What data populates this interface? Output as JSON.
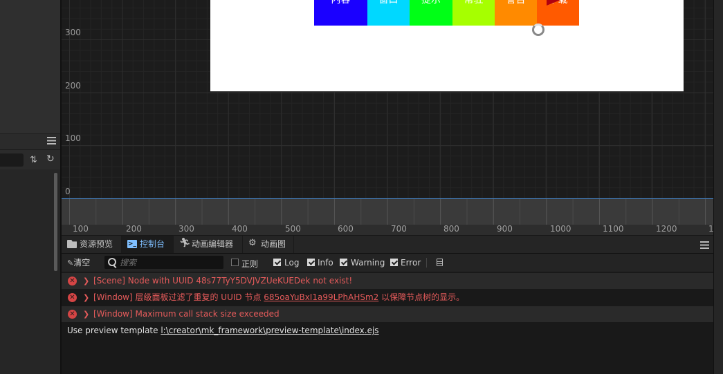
{
  "scene": {
    "y_labels": [
      "300",
      "200",
      "100",
      "0"
    ],
    "x_labels": [
      "100",
      "200",
      "300",
      "400",
      "500",
      "600",
      "700",
      "800",
      "900",
      "1000",
      "1100",
      "1200",
      "1"
    ],
    "canvas_buttons": [
      {
        "label": "内容",
        "color": "#1a00ff"
      },
      {
        "label": "窗口",
        "color": "#00d8ff"
      },
      {
        "label": "提示",
        "color": "#00ff16"
      },
      {
        "label": "常驻",
        "color": "#a6ff00"
      },
      {
        "label": "警告",
        "color": "#ff8a00"
      },
      {
        "label": "下载",
        "color": "#ff5a00"
      }
    ]
  },
  "tabs": [
    {
      "label": "资源预览",
      "icon": "folder-icon"
    },
    {
      "label": "控制台",
      "icon": "terminal-icon"
    },
    {
      "label": "动画编辑器",
      "icon": "running-figure-icon"
    },
    {
      "label": "动画图",
      "icon": "animation-graph-icon"
    }
  ],
  "toolbar": {
    "clear_label": "清空",
    "search_placeholder": "搜索",
    "filters": [
      {
        "label": "正则",
        "checked": false
      },
      {
        "label": "Log",
        "checked": true
      },
      {
        "label": "Info",
        "checked": true
      },
      {
        "label": "Warning",
        "checked": true
      },
      {
        "label": "Error",
        "checked": true
      }
    ]
  },
  "messages": [
    {
      "type": "error",
      "text": "[Scene] Node with UUID 48s77TyY5DVJVZUeKUEDek not exist!"
    },
    {
      "type": "error",
      "prefix": "[Window] 层级面板过滤了重复的 UUID 节点 ",
      "link": "685oaYuBxI1a99LPhAHSm2",
      "suffix": " 以保障节点树的显示。"
    },
    {
      "type": "error",
      "text": "[Window] Maximum call stack size exceeded"
    },
    {
      "type": "log",
      "prefix": "Use preview template ",
      "link": "l:\\creator\\mk_framework\\preview-template\\index.ejs"
    }
  ],
  "colors": {
    "accent": "#4a8fd8",
    "error": "#e65b5b",
    "tab_active": "#7fbfff"
  }
}
